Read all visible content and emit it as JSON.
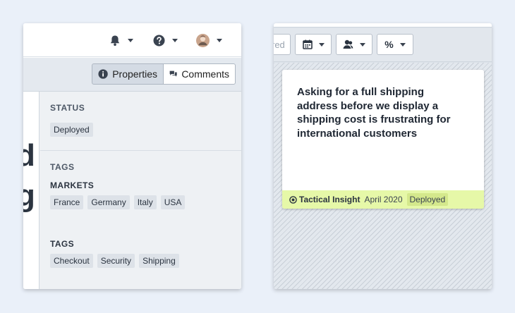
{
  "left_panel": {
    "header": {
      "icons": [
        "bell-icon",
        "help-icon",
        "avatar"
      ]
    },
    "tabs": [
      {
        "label": "Properties",
        "icon": "info-icon",
        "active": true
      },
      {
        "label": "Comments",
        "icon": "comments-icon",
        "active": false
      }
    ],
    "background_fragment": [
      "d",
      "g"
    ],
    "status": {
      "title": "STATUS",
      "value": "Deployed"
    },
    "tags": {
      "title": "TAGS",
      "markets": {
        "title": "MARKETS",
        "items": [
          "France",
          "Germany",
          "Italy",
          "USA"
        ]
      },
      "tags": {
        "title": "TAGS",
        "items": [
          "Checkout",
          "Security",
          "Shipping"
        ]
      }
    }
  },
  "right_panel": {
    "toolbar": {
      "partial_filter": "red",
      "buttons": [
        "calendar-icon",
        "person-icon",
        "percent-icon"
      ],
      "percent_label": "%"
    },
    "card": {
      "text": "Asking for a full shipping address before we display a shipping cost is frustrating for international customers",
      "type": "Tactical Insight",
      "date": "April 2020",
      "status": "Deployed",
      "footer_color": "#e6f8a8"
    }
  }
}
